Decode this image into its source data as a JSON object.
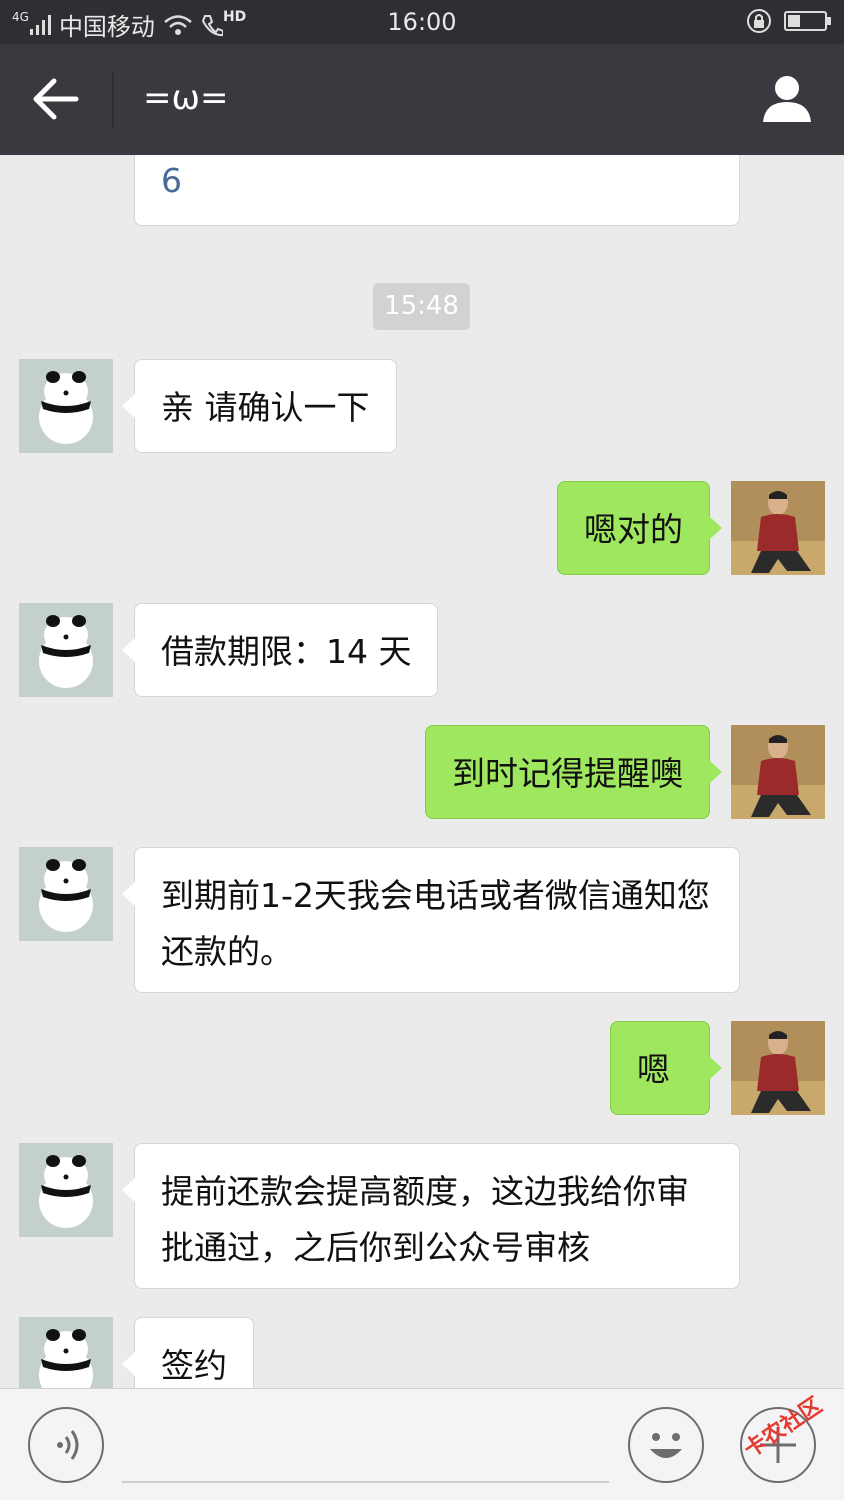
{
  "status_bar": {
    "network": "4G",
    "carrier": "中国移动",
    "hd": "HD",
    "time": "16:00"
  },
  "header": {
    "title": "=ω="
  },
  "messages": [
    {
      "side": "in",
      "text": "6",
      "partial": true
    },
    {
      "side": "time",
      "text": "15:48"
    },
    {
      "side": "in",
      "text": "亲 请确认一下"
    },
    {
      "side": "out",
      "text": "嗯对的"
    },
    {
      "side": "in",
      "text": "借款期限：14 天"
    },
    {
      "side": "out",
      "text": "到时记得提醒噢"
    },
    {
      "side": "in",
      "text": "到期前1-2天我会电话或者微信通知您还款的。"
    },
    {
      "side": "out",
      "text": "嗯"
    },
    {
      "side": "in",
      "text": "提前还款会提高额度，这边我给你审批通过，之后你到公众号审核"
    },
    {
      "side": "in",
      "text": "签约",
      "partial": true
    }
  ],
  "input_bar": {
    "placeholder": ""
  },
  "watermark": "卡农社区",
  "colors": {
    "nav": "#393a3f",
    "status": "#2e2f33",
    "out_bubble": "#9ee75f",
    "in_bubble": "#ffffff",
    "chat_bg": "#ebebeb"
  }
}
